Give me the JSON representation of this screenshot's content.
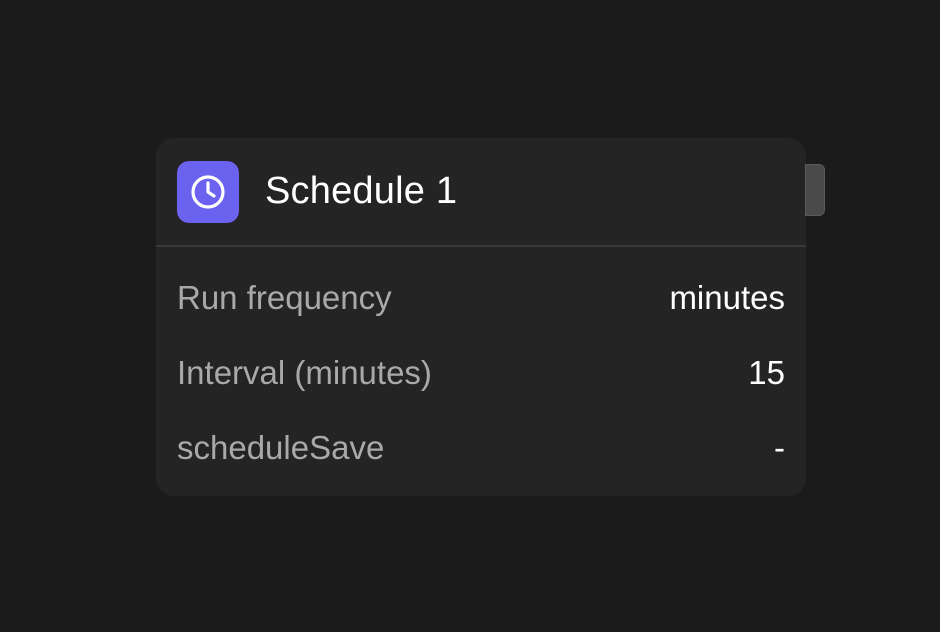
{
  "node": {
    "title": "Schedule 1",
    "icon": "clock-icon",
    "icon_color": "#6b63f0",
    "properties": [
      {
        "label": "Run frequency",
        "value": "minutes"
      },
      {
        "label": "Interval (minutes)",
        "value": "15"
      },
      {
        "label": "scheduleSave",
        "value": "-"
      }
    ]
  },
  "colors": {
    "background": "#1b1b1b",
    "card": "#242424",
    "label": "#a9a9a9",
    "value": "#ffffff"
  }
}
